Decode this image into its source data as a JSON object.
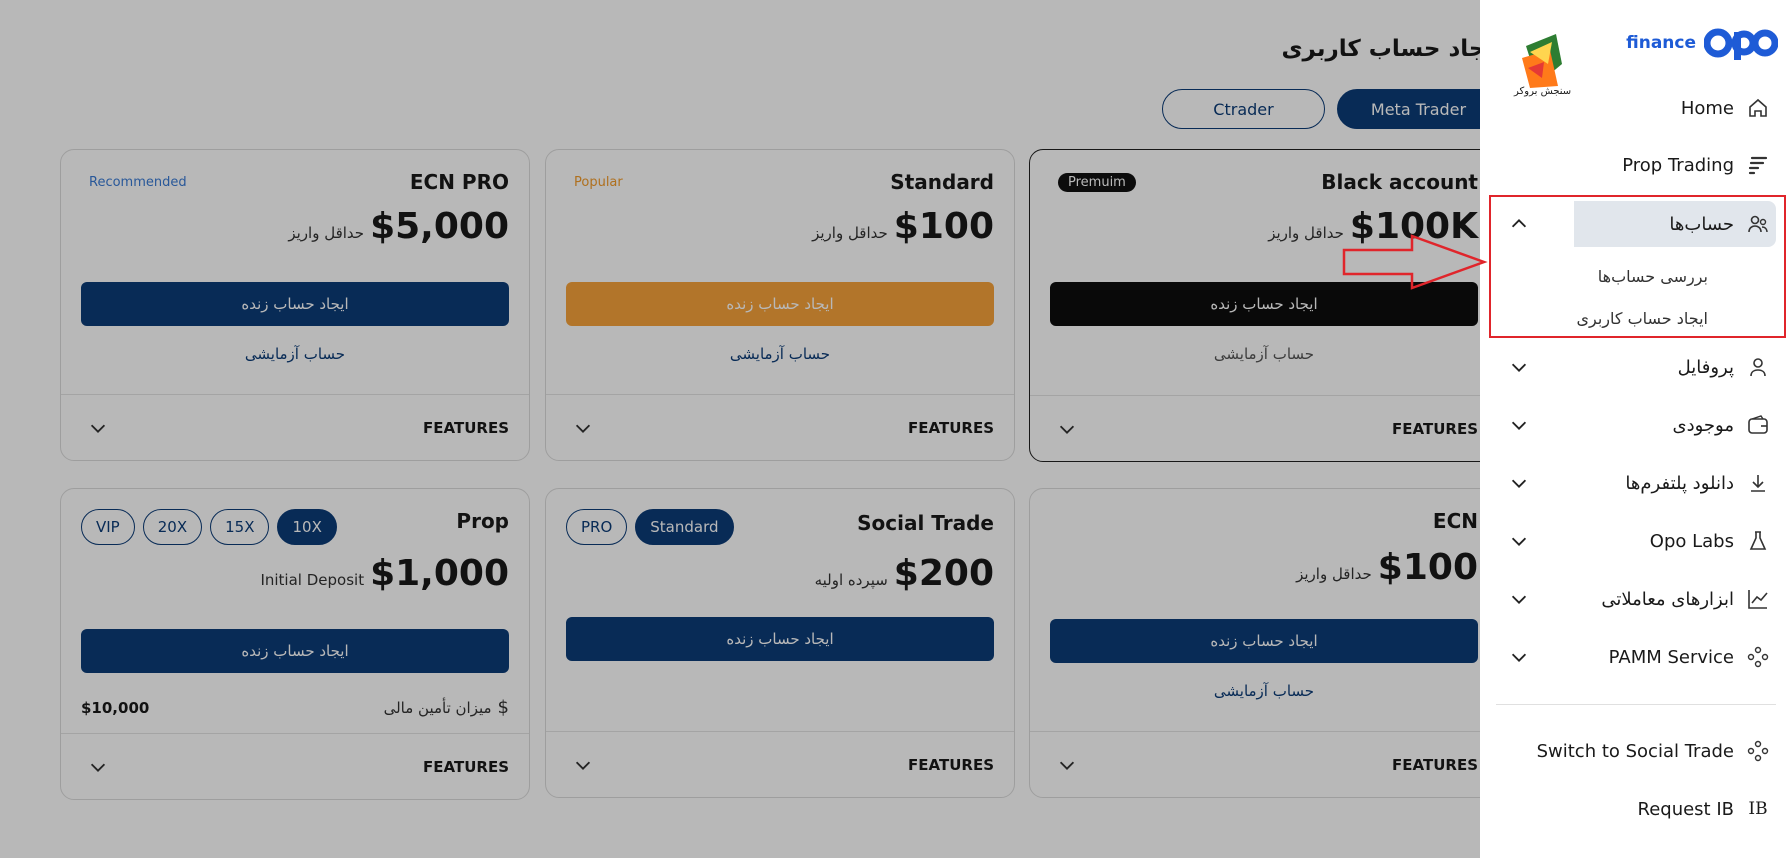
{
  "page": {
    "title": "ایجاد حساب کاربری"
  },
  "platforms": [
    {
      "label": "Ctrader",
      "active": false
    },
    {
      "label": "Meta Trader",
      "active": true
    }
  ],
  "cards": {
    "ecn_pro": {
      "name": "ECN PRO",
      "badge": "Recommended",
      "amount": "$5,000",
      "amount_label": "حداقل واریز",
      "button": "ایجاد حساب زنده",
      "demo": "حساب آزمایشی",
      "features": "FEATURES"
    },
    "standard": {
      "name": "Standard",
      "badge": "Popular",
      "amount": "$100",
      "amount_label": "حداقل واریز",
      "button": "ایجاد حساب زنده",
      "demo": "حساب آزمایشی",
      "features": "FEATURES"
    },
    "black": {
      "name": "Black account",
      "badge": "Premuim",
      "amount": "$100K",
      "amount_label": "حداقل واریز",
      "button": "ایجاد حساب زنده",
      "demo": "حساب آزمایشی",
      "features": "FEATURES"
    },
    "prop": {
      "name": "Prop",
      "pills": [
        "VIP",
        "20X",
        "15X",
        "10X"
      ],
      "active_pill": "10X",
      "amount": "$1,000",
      "amount_label": "Initial Deposit",
      "button": "ایجاد حساب زنده",
      "funding_label": "میزان تأمین مالی",
      "funding_value": "$10,000",
      "features": "FEATURES"
    },
    "social": {
      "name": "Social Trade",
      "pills": [
        "PRO",
        "Standard"
      ],
      "active_pill": "Standard",
      "amount": "$200",
      "amount_label": "سپرده اولیه",
      "button": "ایجاد حساب زنده",
      "features": "FEATURES"
    },
    "ecn": {
      "name": "ECN",
      "amount": "$100",
      "amount_label": "حداقل واریز",
      "button": "ایجاد حساب زنده",
      "demo": "حساب آزمایشی",
      "features": "FEATURES"
    }
  },
  "sidebar": {
    "brand": "finance",
    "broker_logo_text": "سنجش بروکر",
    "items": {
      "home": "Home",
      "prop_trading": "Prop Trading",
      "accounts": "حساب‌ها",
      "accounts_sub": [
        "بررسی حساب‌ها",
        "ایجاد حساب کاربری"
      ],
      "profile": "پروفایل",
      "balance": "موجودی",
      "download": "دانلود پلتفرم‌ها",
      "labs": "Opo Labs",
      "tools": "ابزارهای معاملاتی",
      "pamm": "PAMM Service",
      "switch_social": "Switch to Social Trade",
      "request_ib": "Request IB"
    }
  },
  "colors": {
    "primary": "#0c3c78",
    "orange": "#f7a33b",
    "highlight": "#e0252b",
    "brand_blue": "#1e5bd6"
  }
}
